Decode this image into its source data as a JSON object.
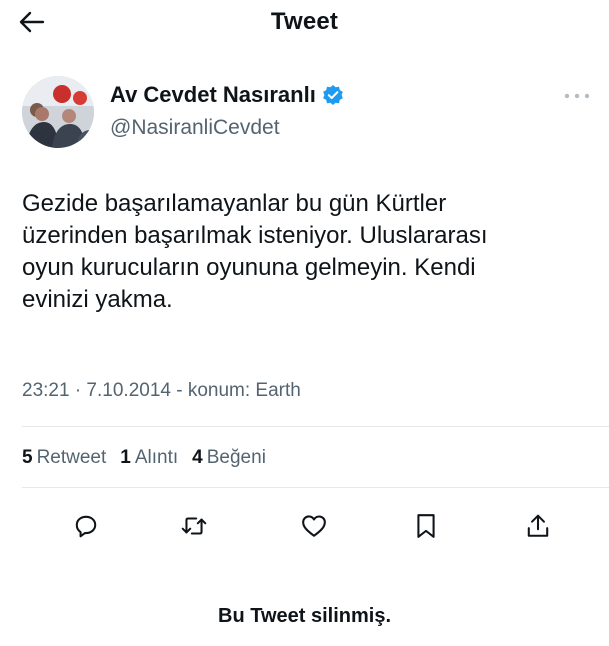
{
  "header": {
    "title": "Tweet",
    "back_icon": "arrow-left-icon"
  },
  "author": {
    "display_name": "Av Cevdet Nasıranlı",
    "handle": "@NasiranliCevdet",
    "verified_icon": "verified-badge-icon",
    "verified_color": "#1d9bf0"
  },
  "tweet": {
    "text_lines": [
      "Gezide başarılamayanlar bu gün Kürtler",
      "üzerinden başarılmak isteniyor. Uluslararası",
      "oyun kurucuların oyununa gelmeyin. Kendi",
      "evinizi yakma."
    ],
    "timestamp": "23:21 · 7.10.2014 - konum: Earth"
  },
  "stats": {
    "retweets_count": "5",
    "retweets_label": "Retweet",
    "quotes_count": "1",
    "quotes_label": "Alıntı",
    "likes_count": "4",
    "likes_label": "Beğeni"
  },
  "actions": [
    "reply-icon",
    "retweet-icon",
    "like-icon",
    "bookmark-icon",
    "share-icon"
  ],
  "footer_note": "Bu Tweet silinmiş.",
  "colors": {
    "text": "#0f1419",
    "secondary": "#536471",
    "divider": "#e6e9ec"
  }
}
